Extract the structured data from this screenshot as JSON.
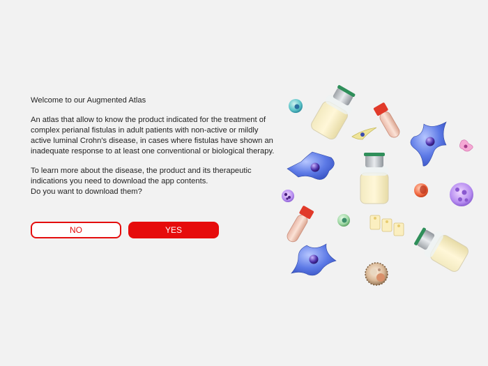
{
  "intro": {
    "welcome": "Welcome to our Augmented Atlas",
    "description": "An atlas that allow to know the product indicated for the treatment of complex perianal fistulas in adult patients with non-active or mildly active luminal Crohn's disease, in cases where fistulas have shown an inadequate response to at least one conventional or biological therapy.",
    "learn_more": "To learn more about the disease, the product and its therapeutic indications you need to download the app contents.",
    "question": "Do you want to download them?"
  },
  "buttons": {
    "no_label": "NO",
    "yes_label": "YES"
  },
  "colors": {
    "accent": "#e60c0c",
    "background": "#f2f2f2"
  },
  "illustration": {
    "icons": [
      "medicine-vial-icon",
      "blood-tube-icon",
      "dendritic-cell-icon",
      "lymphocyte-icon",
      "macrophage-icon",
      "stem-cell-icon",
      "eosinophil-icon",
      "platelet-cluster-icon"
    ]
  }
}
